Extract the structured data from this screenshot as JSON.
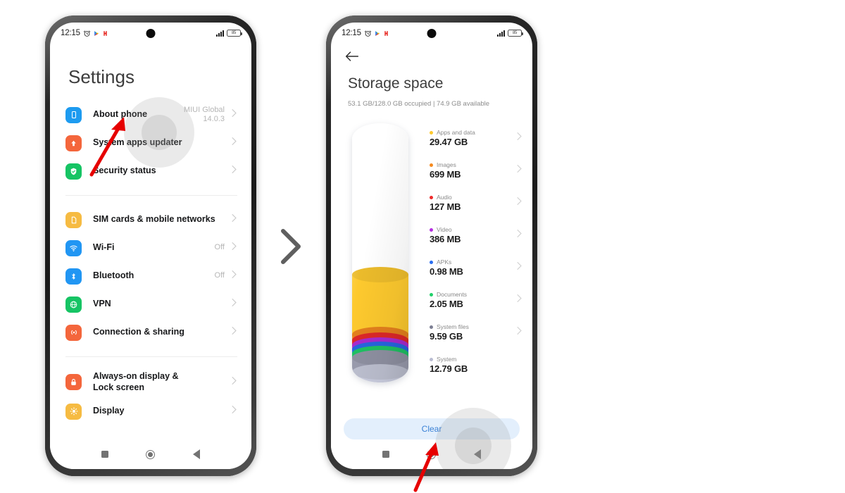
{
  "status_bar": {
    "time": "12:15",
    "battery_level": "85",
    "icons": [
      "alarm-clock-icon",
      "play-store-icon",
      "red-app-icon",
      "signal-bars-icon",
      "battery-icon"
    ]
  },
  "separator": {
    "icon": "chevron-right-icon",
    "color": "#5f5f5f"
  },
  "left_phone": {
    "screen_title": "Settings",
    "groups": [
      {
        "items": [
          {
            "label": "About phone",
            "value": "MIUI Global\n14.0.3",
            "icon": "about-phone-icon",
            "color": "#1d9bf0",
            "chevron": true
          },
          {
            "label": "System apps updater",
            "value": "",
            "icon": "system-updater-icon",
            "color": "#f4663c",
            "chevron": true
          },
          {
            "label": "Security status",
            "value": "",
            "icon": "security-shield-icon",
            "color": "#16c464",
            "chevron": true
          }
        ]
      },
      {
        "items": [
          {
            "label": "SIM cards & mobile networks",
            "value": "",
            "icon": "sim-card-icon",
            "color": "#f6bb42",
            "chevron": true
          },
          {
            "label": "Wi-Fi",
            "value": "Off",
            "icon": "wifi-icon",
            "color": "#2196f3",
            "chevron": true
          },
          {
            "label": "Bluetooth",
            "value": "Off",
            "icon": "bluetooth-icon",
            "color": "#2196f3",
            "chevron": true
          },
          {
            "label": "VPN",
            "value": "",
            "icon": "vpn-globe-icon",
            "color": "#16c464",
            "chevron": true
          },
          {
            "label": "Connection & sharing",
            "value": "",
            "icon": "connection-sharing-icon",
            "color": "#f4663c",
            "chevron": true
          }
        ]
      },
      {
        "items": [
          {
            "label": "Always-on display & Lock screen",
            "value": "",
            "icon": "lock-icon",
            "color": "#f4663c",
            "chevron": true
          },
          {
            "label": "Display",
            "value": "",
            "icon": "display-brightness-icon",
            "color": "#f6bb42",
            "chevron": true
          }
        ]
      }
    ],
    "nav_bar": [
      "recents-square-icon",
      "home-circle-icon",
      "back-triangle-icon"
    ]
  },
  "right_phone": {
    "back_icon": "back-arrow-icon",
    "screen_title": "Storage space",
    "subtitle": "53.1 GB/128.0 GB occupied | 74.9 GB available",
    "clear_button": "Clear",
    "nav_bar": [
      "recents-square-icon",
      "home-circle-icon",
      "back-triangle-icon"
    ],
    "storage_categories": [
      {
        "name": "Apps and data",
        "value": "29.47 GB",
        "color": "#fdc92e",
        "chevron": true
      },
      {
        "name": "Images",
        "value": "699 MB",
        "color": "#f58a1f",
        "chevron": true
      },
      {
        "name": "Audio",
        "value": "127 MB",
        "color": "#ee2b2b",
        "chevron": true
      },
      {
        "name": "Video",
        "value": "386 MB",
        "color": "#b42ee0",
        "chevron": true
      },
      {
        "name": "APKs",
        "value": "0.98 MB",
        "color": "#2a6ef0",
        "chevron": true
      },
      {
        "name": "Documents",
        "value": "2.05 MB",
        "color": "#21d06a",
        "chevron": true
      },
      {
        "name": "System files",
        "value": "9.59 GB",
        "color": "#7d7f94",
        "chevron": true
      },
      {
        "name": "System",
        "value": "12.79 GB",
        "color": "#b9bcd2",
        "chevron": false
      }
    ],
    "cylinder_segments": [
      {
        "name": "Free space",
        "color": "#ffffff",
        "pct": 58.5
      },
      {
        "name": "Apps and data",
        "color": "#fdc92e",
        "pct": 23.0
      },
      {
        "name": "Images",
        "color": "#f58a1f",
        "pct": 2.2
      },
      {
        "name": "Audio",
        "color": "#ee2b2b",
        "pct": 1.8
      },
      {
        "name": "Video",
        "color": "#b42ee0",
        "pct": 1.8
      },
      {
        "name": "APKs",
        "color": "#2a6ef0",
        "pct": 1.5
      },
      {
        "name": "Documents",
        "color": "#21d06a",
        "pct": 1.7
      },
      {
        "name": "System files",
        "color": "#9a9cae",
        "pct": 5.5
      },
      {
        "name": "System",
        "color": "#cbcee0",
        "pct": 4.0
      }
    ]
  },
  "annotations": [
    {
      "name": "arrow-to-about-phone",
      "color": "#e60000"
    },
    {
      "name": "arrow-to-clear-button",
      "color": "#e60000"
    }
  ]
}
